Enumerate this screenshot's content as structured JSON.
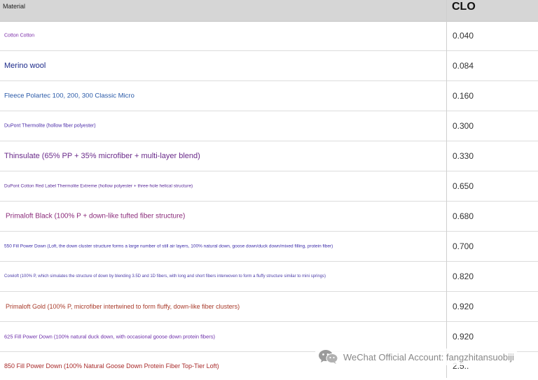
{
  "header": {
    "material_label": "Material",
    "clo_label": "CLO"
  },
  "rows": [
    {
      "material": "Cotton Cotton",
      "clo": "0.040",
      "color": "#7a2aa8"
    },
    {
      "material": "Merino wool",
      "clo": "0.084",
      "color": "#1c2a8a"
    },
    {
      "material": "Fleece Polartec 100, 200, 300 Classic Micro",
      "clo": "0.160",
      "color": "#2a5aa8"
    },
    {
      "material": "DuPont Thermolite (hollow fiber polyester)",
      "clo": "0.300",
      "color": "#4a2aa8"
    },
    {
      "material": "Thinsulate (65% PP + 35% microfiber + multi-layer blend)",
      "clo": "0.330",
      "color": "#6a2a8a"
    },
    {
      "material": "DuPont Cotton Red Label Thermolite Extreme (hollow polyester + three-hole helical structure)",
      "clo": "0.650",
      "color": "#5a2a9a"
    },
    {
      "material": "Primaloft Black (100% P + down-like tufted fiber structure)",
      "clo": "0.680",
      "color": "#8a2a7a"
    },
    {
      "material": "550 Fill Power Down (Loft, the down cluster structure forms a large number of still air layers, 100% natural down, goose down/duck down/mixed filling, protein fiber)",
      "clo": "0.700",
      "color": "#3a2aa8"
    },
    {
      "material": "Coreloft (100% P, which simulates the structure of down by blending 3.5D and 1D fibers, with long and short fibers interwoven to form a fluffy structure similar to mini springs)",
      "clo": "0.820",
      "color": "#4a3aa8"
    },
    {
      "material": "Primaloft Gold (100% P, microfiber intertwined to form fluffy, down-like fiber clusters)",
      "clo": "0.920",
      "color": "#a83a2a"
    },
    {
      "material": "625 Fill Power Down (100% natural duck down, with occasional goose down protein fibers)",
      "clo": "0.920",
      "color": "#6a2aa8"
    },
    {
      "material": "850 Fill Power Down (100% Natural Goose Down Protein Fiber Top-Tier Loft)",
      "clo": "2.5..",
      "color": "#a82a2a"
    }
  ],
  "watermark": {
    "icon": "wechat-icon",
    "text": "WeChat Official Account: fangzhitansuobiji"
  }
}
